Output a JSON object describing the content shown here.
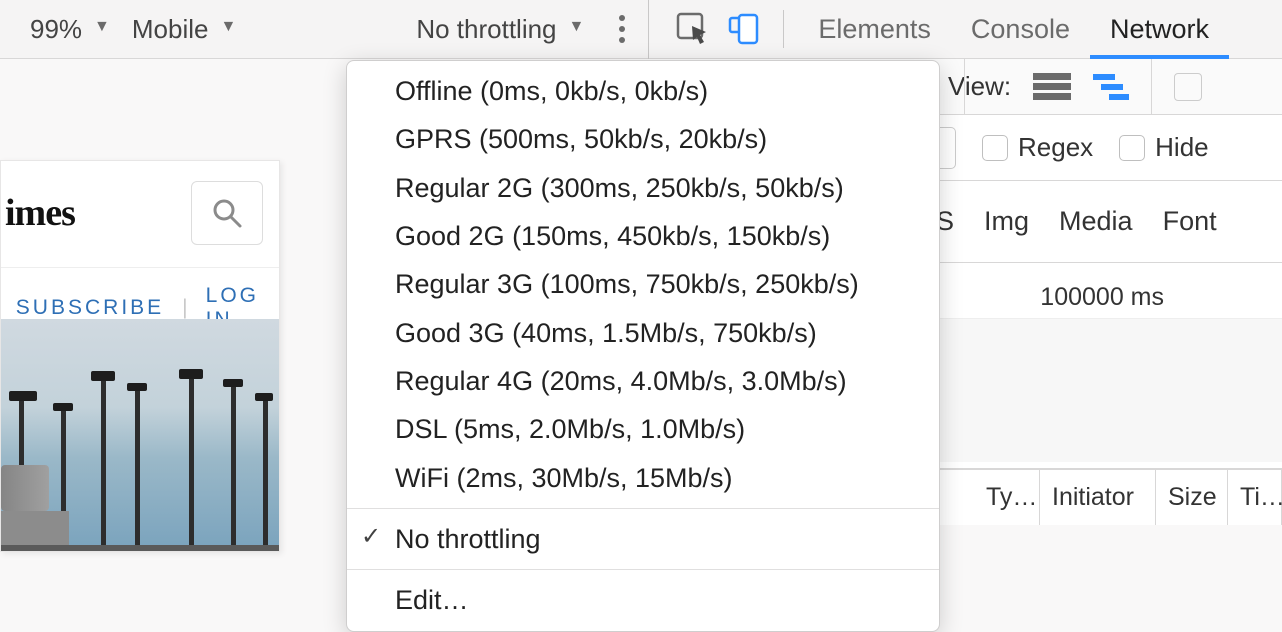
{
  "toolbar": {
    "zoom": "99%",
    "device": "Mobile",
    "throttling_selected": "No throttling"
  },
  "throttling_menu": {
    "presets": [
      "Offline (0ms, 0kb/s, 0kb/s)",
      "GPRS (500ms, 50kb/s, 20kb/s)",
      "Regular 2G (300ms, 250kb/s, 50kb/s)",
      "Good 2G (150ms, 450kb/s, 150kb/s)",
      "Regular 3G (100ms, 750kb/s, 250kb/s)",
      "Good 3G (40ms, 1.5Mb/s, 750kb/s)",
      "Regular 4G (20ms, 4.0Mb/s, 3.0Mb/s)",
      "DSL (5ms, 2.0Mb/s, 1.0Mb/s)",
      "WiFi (2ms, 30Mb/s, 15Mb/s)"
    ],
    "no_throttling": "No throttling",
    "edit": "Edit…"
  },
  "devtools_tabs": {
    "elements": "Elements",
    "console": "Console",
    "network": "Network"
  },
  "network_panel": {
    "view_label": "View:",
    "regex_label": "Regex",
    "hide_label": "Hide",
    "resource_types": {
      "s": "S",
      "img": "Img",
      "media": "Media",
      "font": "Font"
    },
    "timeline_max_label": "100000 ms",
    "columns": {
      "type": "Ty…",
      "initiator": "Initiator",
      "size": "Size",
      "time": "Ti…"
    }
  },
  "mobile_preview": {
    "logo": "imes",
    "subscribe": "SUBSCRIBE",
    "login": "LOG IN"
  }
}
